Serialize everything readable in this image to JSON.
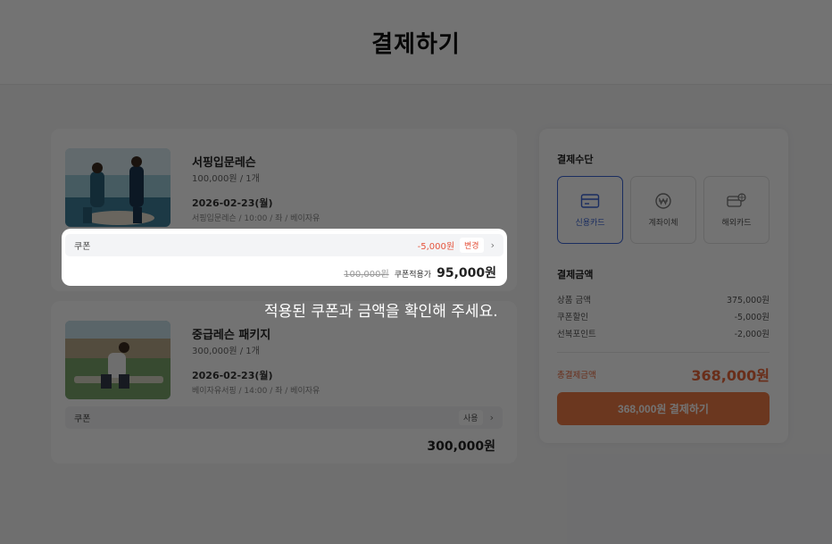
{
  "header": {
    "title": "결제하기"
  },
  "products": [
    {
      "title": "서핑입문레슨",
      "price": "100,000원 / 1개",
      "date": "2026-02-23(월)",
      "detail": "서핑입문레슨 / 10:00 / 좌 / 베이자유",
      "coupon": {
        "label": "쿠폰",
        "discount": "-5,000원",
        "button": "변경",
        "original_price": "100,000원",
        "applied_label": "쿠폰적용가",
        "final_price": "95,000원"
      }
    },
    {
      "title": "중급레슨 패키지",
      "price": "300,000원 / 1개",
      "date": "2026-02-23(월)",
      "detail": "베이자유서핑 / 14:00 / 좌 / 베이자유",
      "coupon": {
        "label": "쿠폰",
        "button": "사용"
      },
      "total": "300,000원"
    }
  ],
  "hint": "적용된 쿠폰과 금액을 확인해 주세요.",
  "payment": {
    "method_title": "결제수단",
    "methods": [
      {
        "label": "신용카드",
        "icon": "credit-card-icon",
        "selected": true
      },
      {
        "label": "계좌이체",
        "icon": "won-coin-icon",
        "selected": false
      },
      {
        "label": "해외카드",
        "icon": "foreign-card-icon",
        "selected": false
      }
    ],
    "amount_title": "결제금액",
    "rows": [
      {
        "label": "상품 금액",
        "value": "375,000원"
      },
      {
        "label": "쿠폰할인",
        "value": "-5,000원"
      },
      {
        "label": "선복포인트",
        "value": "-2,000원"
      }
    ],
    "total_label": "총결제금액",
    "total_value": "368,000원",
    "pay_button": "368,000원 결제하기"
  },
  "colors": {
    "accent": "#ee7a45",
    "selected_border": "#3b64d6",
    "discount": "#e5533c",
    "overlay": "rgba(0,0,0,0.55)"
  }
}
